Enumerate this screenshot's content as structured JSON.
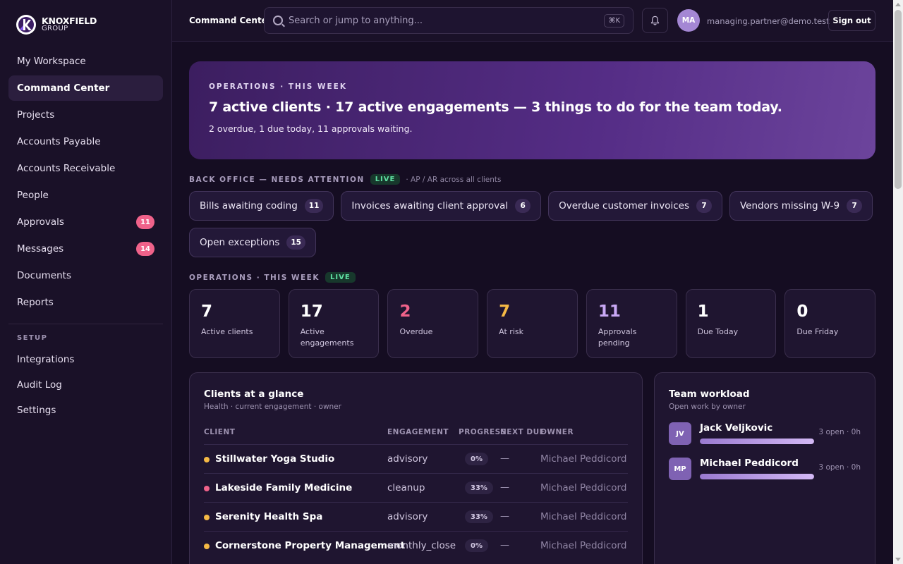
{
  "brand": {
    "name": "KNOXFIELD",
    "sub": "GROUP"
  },
  "sidebar": {
    "items": [
      {
        "label": "My Workspace"
      },
      {
        "label": "Command Center",
        "active": true
      },
      {
        "label": "Projects"
      },
      {
        "label": "Accounts Payable"
      },
      {
        "label": "Accounts Receivable"
      },
      {
        "label": "People"
      },
      {
        "label": "Approvals",
        "badge": "11"
      },
      {
        "label": "Messages",
        "badge": "14"
      },
      {
        "label": "Documents"
      },
      {
        "label": "Reports"
      }
    ],
    "setup_label": "SETUP",
    "setup_items": [
      {
        "label": "Integrations"
      },
      {
        "label": "Audit Log"
      },
      {
        "label": "Settings"
      }
    ]
  },
  "topbar": {
    "title": "Command Center",
    "search_placeholder": "Search or jump to anything...",
    "shortcut": "⌘K",
    "avatar_initials": "MA",
    "user_email": "managing.partner@demo.test",
    "signout_label": "Sign out"
  },
  "hero": {
    "eyebrow": "OPERATIONS · THIS WEEK",
    "headline": "7 active clients · 17 active engagements — 3 things to do for the team today.",
    "subtext": "2 overdue, 1 due today, 11 approvals waiting."
  },
  "back_office": {
    "label": "BACK OFFICE — NEEDS ATTENTION",
    "live": "LIVE",
    "note": "· AP / AR across all clients",
    "pills": [
      {
        "label": "Bills awaiting coding",
        "count": "11"
      },
      {
        "label": "Invoices awaiting client approval",
        "count": "6"
      },
      {
        "label": "Overdue customer invoices",
        "count": "7"
      },
      {
        "label": "Vendors missing W-9",
        "count": "7"
      },
      {
        "label": "Open exceptions",
        "count": "15"
      }
    ]
  },
  "operations": {
    "label": "OPERATIONS · THIS WEEK",
    "live": "LIVE",
    "stats": [
      {
        "value": "7",
        "label": "Active clients",
        "color": "#ffffff"
      },
      {
        "value": "17",
        "label": "Active engagements",
        "color": "#ffffff"
      },
      {
        "value": "2",
        "label": "Overdue",
        "color": "#f0628a"
      },
      {
        "value": "7",
        "label": "At risk",
        "color": "#f5b945"
      },
      {
        "value": "11",
        "label": "Approvals pending",
        "color": "#c9a8f5"
      },
      {
        "value": "1",
        "label": "Due Today",
        "color": "#ffffff"
      },
      {
        "value": "0",
        "label": "Due Friday",
        "color": "#ffffff"
      }
    ]
  },
  "clients": {
    "title": "Clients at a glance",
    "subtitle": "Health · current engagement · owner",
    "columns": [
      "CLIENT",
      "ENGAGEMENT",
      "PROGRESS",
      "NEXT DUE",
      "OWNER"
    ],
    "rows": [
      {
        "name": "Stillwater Yoga Studio",
        "engagement": "advisory",
        "progress": "0%",
        "due": "—",
        "owner": "Michael Peddicord",
        "status_color": "#f5b945"
      },
      {
        "name": "Lakeside Family Medicine",
        "engagement": "cleanup",
        "progress": "33%",
        "due": "—",
        "owner": "Michael Peddicord",
        "status_color": "#f0628a"
      },
      {
        "name": "Serenity Health Spa",
        "engagement": "advisory",
        "progress": "33%",
        "due": "—",
        "owner": "Michael Peddicord",
        "status_color": "#f5b945"
      },
      {
        "name": "Cornerstone Property Management",
        "engagement": "monthly_close",
        "progress": "0%",
        "due": "—",
        "owner": "Michael Peddicord",
        "status_color": "#f5b945"
      }
    ]
  },
  "workload": {
    "title": "Team workload",
    "subtitle": "Open work by owner",
    "people": [
      {
        "initials": "JV",
        "name": "Jack Veljkovic",
        "meta": "3 open · 0h",
        "load": 1.0
      },
      {
        "initials": "MP",
        "name": "Michael Peddicord",
        "meta": "3 open · 0h",
        "load": 1.0
      }
    ]
  }
}
